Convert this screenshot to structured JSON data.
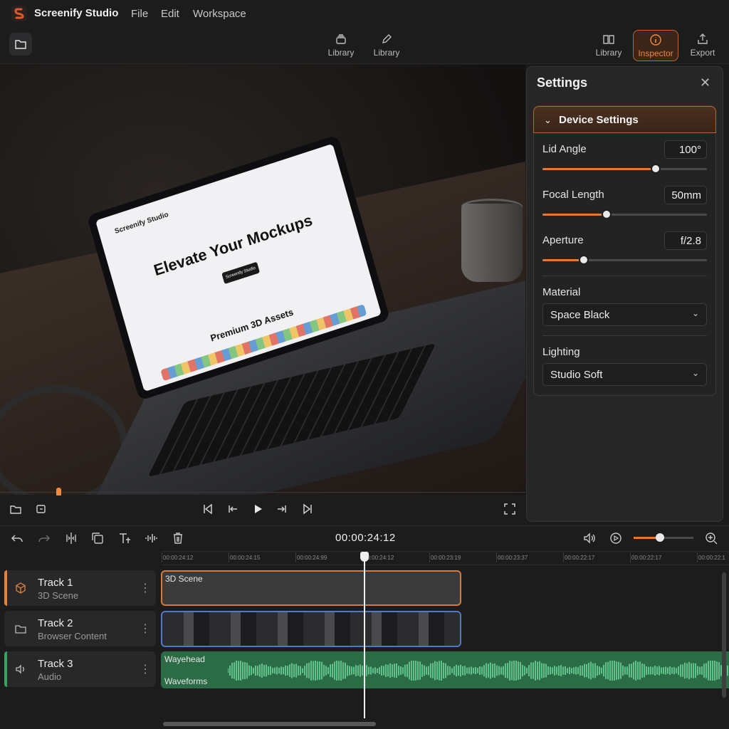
{
  "app": {
    "title": "Screenify Studio",
    "brand_color": "#e25a2c"
  },
  "menu": [
    "File",
    "Edit",
    "Workspace"
  ],
  "toolbar": {
    "center": [
      {
        "label": "Library",
        "icon": "stack-icon"
      },
      {
        "label": "Library",
        "icon": "pen-icon"
      }
    ],
    "right": [
      {
        "label": "Library",
        "icon": "book-icon"
      },
      {
        "label": "Inspector",
        "icon": "info-icon",
        "active": true
      },
      {
        "label": "Export",
        "icon": "export-icon"
      }
    ],
    "accent": "#f08a3d"
  },
  "preview": {
    "screen": {
      "brand": "Screenify Studio",
      "headline": "Elevate Your Mockups",
      "button": "Screenify Studio",
      "section": "Premium 3D Assets"
    }
  },
  "settings": {
    "title": "Settings",
    "group_title": "Device Settings",
    "params": [
      {
        "label": "Lid Angle",
        "value": "100°",
        "level": 0.69
      },
      {
        "label": "Focal Length",
        "value": "50mm",
        "level": 0.39
      },
      {
        "label": "Aperture",
        "value": "f/2.8",
        "level": 0.25
      }
    ],
    "material": {
      "label": "Material",
      "value": "Space Black"
    },
    "lighting": {
      "label": "Lighting",
      "value": "Studio Soft"
    }
  },
  "timeline": {
    "timecode": "00:00:24:12",
    "zoom_level": 0.44,
    "ruler": [
      "00:00:24:12",
      "00:00:24:15",
      "00:00:24:99",
      "00:00:24:12",
      "00:00:23:19",
      "00:00:23:37",
      "00:00:22:17",
      "00:00:22:17",
      "00:00:22:1"
    ],
    "tracks": [
      {
        "name": "Track 1",
        "sub": "3D Scene",
        "accent": "#e2833e",
        "clip": "3D Scene"
      },
      {
        "name": "Track 2",
        "sub": "Browser Content",
        "accent": "#3b3b3b",
        "clip": ""
      },
      {
        "name": "Track 3",
        "sub": "Audio",
        "accent": "#3aa266",
        "clip_top": "Wayehead",
        "clip_bottom": "Waveforms"
      }
    ]
  }
}
